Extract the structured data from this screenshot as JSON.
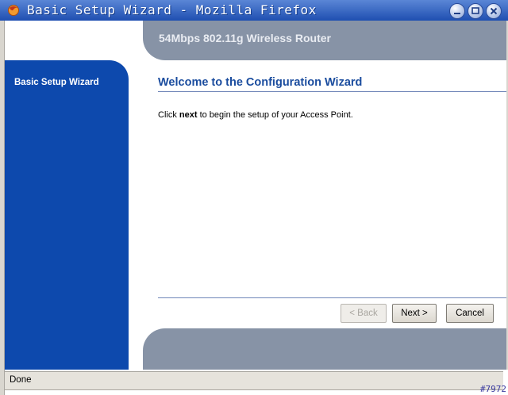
{
  "window": {
    "title": "Basic Setup Wizard - Mozilla Firefox"
  },
  "header": {
    "title": "54Mbps 802.11g Wireless Router"
  },
  "sidebar": {
    "items": [
      {
        "label": "Basic Setup Wizard"
      }
    ]
  },
  "main": {
    "heading": "Welcome to the Configuration Wizard",
    "instruction_prefix": "Click ",
    "instruction_bold": "next",
    "instruction_suffix": " to begin the setup of your Access Point."
  },
  "buttons": {
    "back": "< Back",
    "next": "Next >",
    "cancel": "Cancel"
  },
  "statusbar": {
    "text": "Done"
  },
  "watermark": "#7972",
  "icons": {
    "app": "firefox-icon",
    "minimize": "minimize-icon",
    "maximize": "maximize-icon",
    "close": "close-icon"
  },
  "colors": {
    "sidebar": "#0d49ad",
    "header_band": "#8793a6",
    "heading": "#1a4c9e"
  }
}
